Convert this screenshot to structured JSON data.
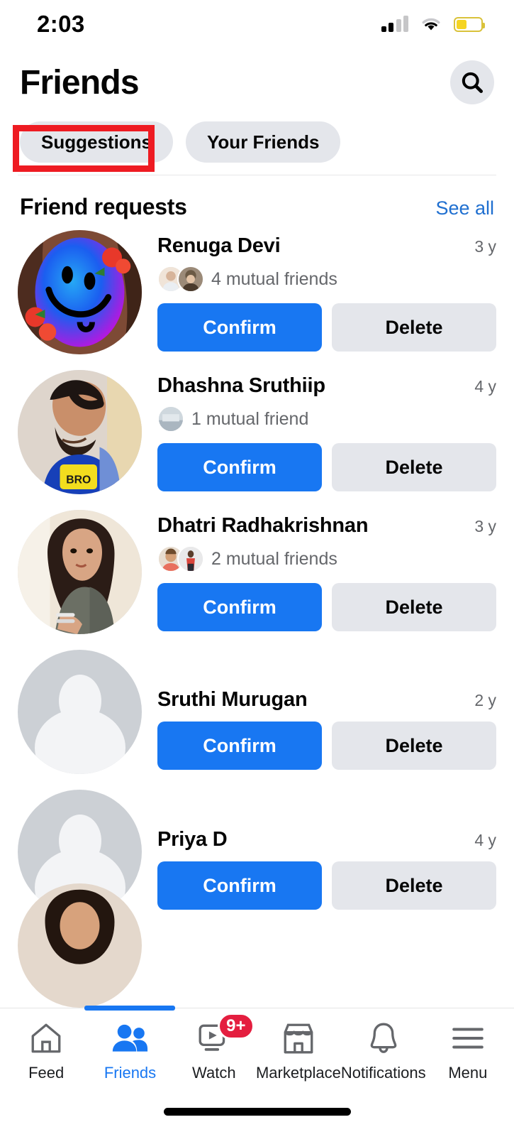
{
  "status_bar": {
    "time": "2:03",
    "icons": [
      "cellular-signal-icon",
      "wifi-icon",
      "battery-icon"
    ],
    "battery_color": "#f5d422",
    "battery_level_pct": 42
  },
  "header": {
    "title": "Friends",
    "search_icon": "search-icon"
  },
  "tabs": [
    {
      "label": "Suggestions",
      "selected": true,
      "highlighted": true
    },
    {
      "label": "Your Friends",
      "selected": false,
      "highlighted": false
    }
  ],
  "highlight": {
    "color": "#ee1b22",
    "target": "Suggestions"
  },
  "section": {
    "title": "Friend requests",
    "see_all_label": "See all",
    "see_all_color": "#1f6fd0"
  },
  "buttons": {
    "confirm_label": "Confirm",
    "delete_label": "Delete",
    "confirm_color": "#1877f2",
    "delete_color": "#e4e6eb"
  },
  "requests": [
    {
      "name": "Renuga Devi",
      "time": "3 y",
      "mutual_text": "4 mutual friends",
      "mutual_face_count": 2,
      "avatar_type": "photo",
      "avatar_name": "avatar-renuga-devi"
    },
    {
      "name": "Dhashna Sruthiip",
      "time": "4 y",
      "mutual_text": "1 mutual friend",
      "mutual_face_count": 1,
      "avatar_type": "photo",
      "avatar_name": "avatar-dhashna-sruthiip"
    },
    {
      "name": "Dhatri Radhakrishnan",
      "time": "3 y",
      "mutual_text": "2 mutual friends",
      "mutual_face_count": 2,
      "avatar_type": "photo",
      "avatar_name": "avatar-dhatri-radhakrishnan"
    },
    {
      "name": "Sruthi Murugan",
      "time": "2 y",
      "mutual_text": "",
      "mutual_face_count": 0,
      "avatar_type": "placeholder",
      "avatar_name": "avatar-sruthi-murugan"
    },
    {
      "name": "Priya D",
      "time": "4 y",
      "mutual_text": "",
      "mutual_face_count": 0,
      "avatar_type": "placeholder",
      "avatar_name": "avatar-priya-d"
    }
  ],
  "bottom_nav": {
    "items": [
      {
        "label": "Feed",
        "icon": "home-icon",
        "active": false,
        "badge": ""
      },
      {
        "label": "Friends",
        "icon": "friends-icon",
        "active": true,
        "badge": ""
      },
      {
        "label": "Watch",
        "icon": "watch-icon",
        "active": false,
        "badge": "9+"
      },
      {
        "label": "Marketplace",
        "icon": "marketplace-icon",
        "active": false,
        "badge": ""
      },
      {
        "label": "Notifications",
        "icon": "bell-icon",
        "active": false,
        "badge": ""
      },
      {
        "label": "Menu",
        "icon": "hamburger-menu-icon",
        "active": false,
        "badge": ""
      }
    ],
    "active_color": "#1877f2",
    "badge_color": "#e41e3f"
  }
}
